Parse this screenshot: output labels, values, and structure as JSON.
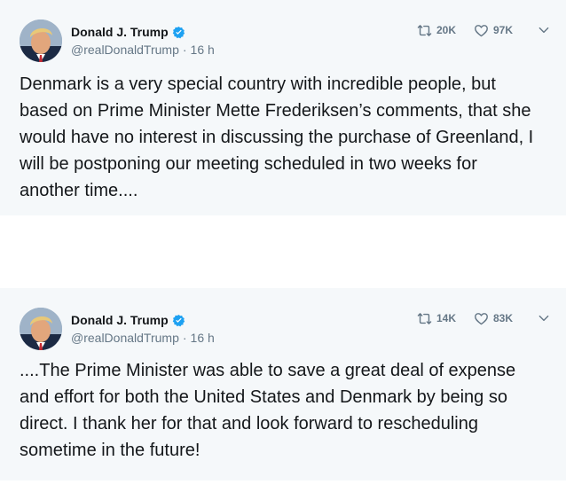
{
  "colors": {
    "card_background": "#f5f8fa",
    "page_background": "#ffffff",
    "text_primary": "#14171a",
    "text_secondary": "#657786",
    "verified_blue": "#1da1f2"
  },
  "tweets": [
    {
      "author": {
        "name": "Donald J. Trump",
        "handle": "@realDonaldTrump",
        "verified": true
      },
      "time": "16 h",
      "separator": "·",
      "actions": {
        "retweet": {
          "icon": "retweet-icon",
          "count": "20K"
        },
        "like": {
          "icon": "heart-icon",
          "count": "97K"
        },
        "more": {
          "icon": "chevron-down-icon"
        }
      },
      "text": "Denmark is a very special country with incredible people, but based on Prime Minister Mette Frederiksen’s comments, that she would have no interest in discussing the purchase of Greenland, I will be postponing our meeting scheduled in two weeks for another time...."
    },
    {
      "author": {
        "name": "Donald J. Trump",
        "handle": "@realDonaldTrump",
        "verified": true
      },
      "time": "16 h",
      "separator": "·",
      "actions": {
        "retweet": {
          "icon": "retweet-icon",
          "count": "14K"
        },
        "like": {
          "icon": "heart-icon",
          "count": "83K"
        },
        "more": {
          "icon": "chevron-down-icon"
        }
      },
      "text": "....The Prime Minister was able to save a great deal of expense and effort for both the United States and Denmark by being so direct. I thank her for that and look forward to rescheduling sometime in the future!"
    }
  ]
}
